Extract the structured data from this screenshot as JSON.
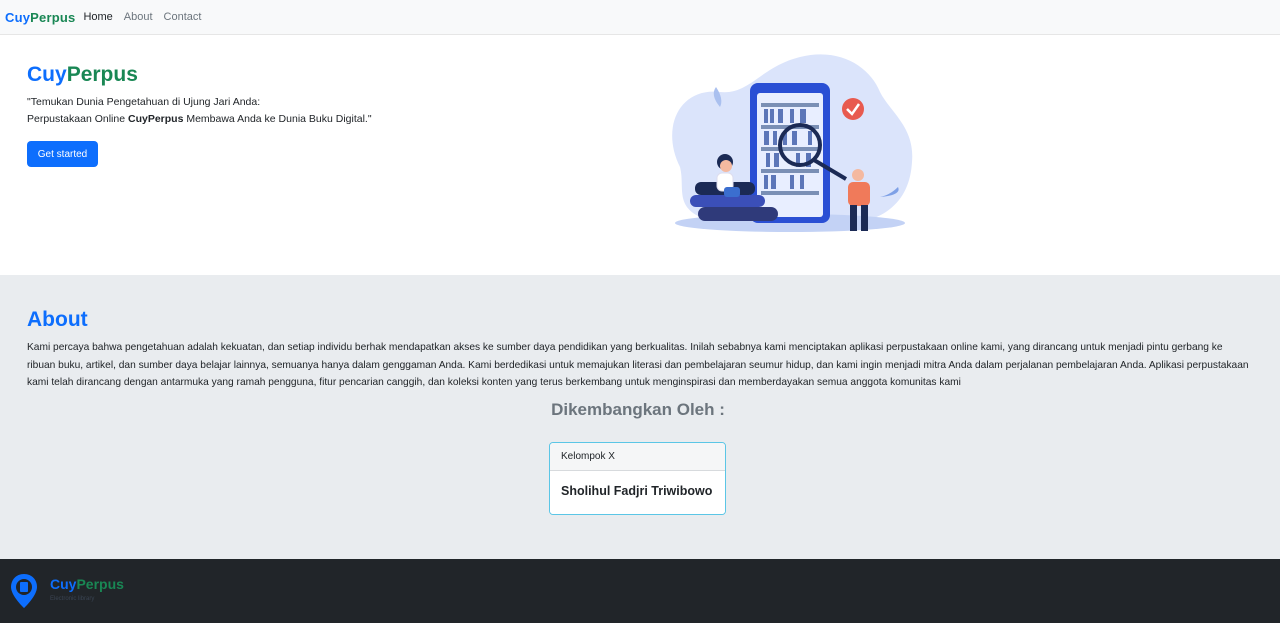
{
  "navbar": {
    "brand_part1": "Cuy",
    "brand_part2": "Perpus",
    "links": [
      "Home",
      "About",
      "Contact"
    ]
  },
  "hero": {
    "title_part1": "Cuy",
    "title_part2": "Perpus",
    "line1": "\"Temukan Dunia Pengetahuan di Ujung Jari Anda:",
    "line2_before": "Perpustakaan Online ",
    "line2_bold": "CuyPerpus",
    "line2_after": " Membawa Anda ke Dunia Buku Digital.\"",
    "cta_label": "Get started",
    "illustration_icon": "library-illustration"
  },
  "about": {
    "title": "About",
    "text": "Kami percaya bahwa pengetahuan adalah kekuatan, dan setiap individu berhak mendapatkan akses ke sumber daya pendidikan yang berkualitas. Inilah sebabnya kami menciptakan aplikasi perpustakaan online kami, yang dirancang untuk menjadi pintu gerbang ke ribuan buku, artikel, dan sumber daya belajar lainnya, semuanya hanya dalam genggaman Anda. Kami berdedikasi untuk memajukan literasi dan pembelajaran seumur hidup, dan kami ingin menjadi mitra Anda dalam perjalanan pembelajaran Anda. Aplikasi perpustakaan kami telah dirancang dengan antarmuka yang ramah pengguna, fitur pencarian canggih, dan koleksi konten yang terus berkembang untuk menginspirasi dan memberdayakan semua anggota komunitas kami",
    "developed_by": "Dikembangkan Oleh :",
    "card_header": "Kelompok X",
    "card_body": "Sholihul Fadjri Triwibowo"
  },
  "footer": {
    "brand_part1": "Cuy",
    "brand_part2": "Perpus",
    "subtitle": "Electronic library",
    "logo_icon": "location-pin-book-icon"
  },
  "colors": {
    "primary": "#0d6efd",
    "success": "#198754",
    "dark": "#212529",
    "light_bg": "#e9ecef"
  }
}
